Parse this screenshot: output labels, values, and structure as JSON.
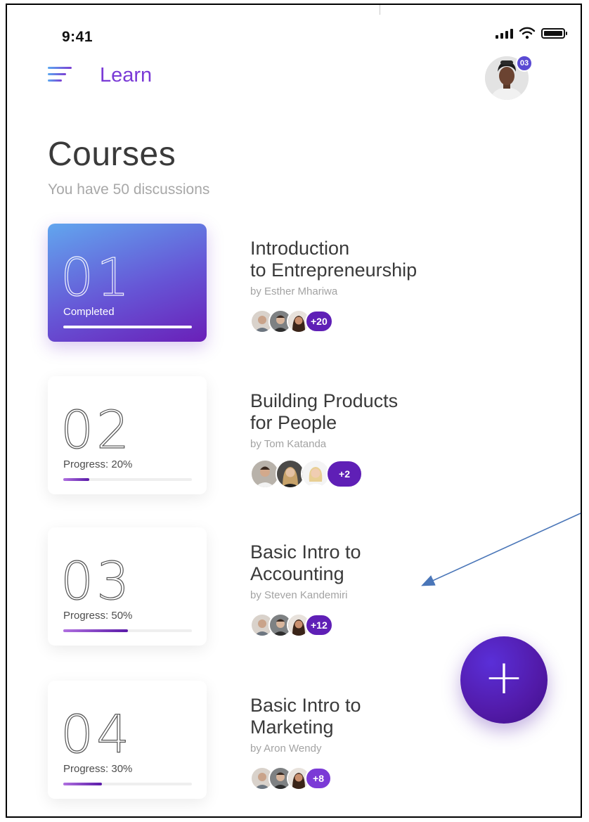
{
  "status_bar": {
    "time": "9:41"
  },
  "header": {
    "title": "Learn",
    "notification_count": "03"
  },
  "page": {
    "title": "Courses",
    "subtitle": "You have 50 discussions"
  },
  "colors": {
    "accent": "#7a3ad6",
    "primary": "#5f1fb6",
    "gradient_start": "#62a6ee"
  },
  "courses": [
    {
      "number": "01",
      "status": "Completed",
      "progress": 1.0,
      "title_line1": "Introduction",
      "title_line2": "to Entrepreneurship",
      "author": "by Esther Mhariwa",
      "more": "+20"
    },
    {
      "number": "02",
      "status": "Progress: 20%",
      "progress": 0.2,
      "title_line1": "Building Products",
      "title_line2": "for People",
      "author": "by Tom Katanda",
      "more": "+2"
    },
    {
      "number": "03",
      "status": "Progress: 50%",
      "progress": 0.5,
      "title_line1": "Basic Intro to",
      "title_line2": "Accounting",
      "author": "by Steven Kandemiri",
      "more": "+12"
    },
    {
      "number": "04",
      "status": "Progress: 30%",
      "progress": 0.3,
      "title_line1": "Basic Intro to",
      "title_line2": "Marketing",
      "author": "by Aron Wendy",
      "more": "+8"
    }
  ],
  "fab": {
    "icon": "plus-icon"
  }
}
